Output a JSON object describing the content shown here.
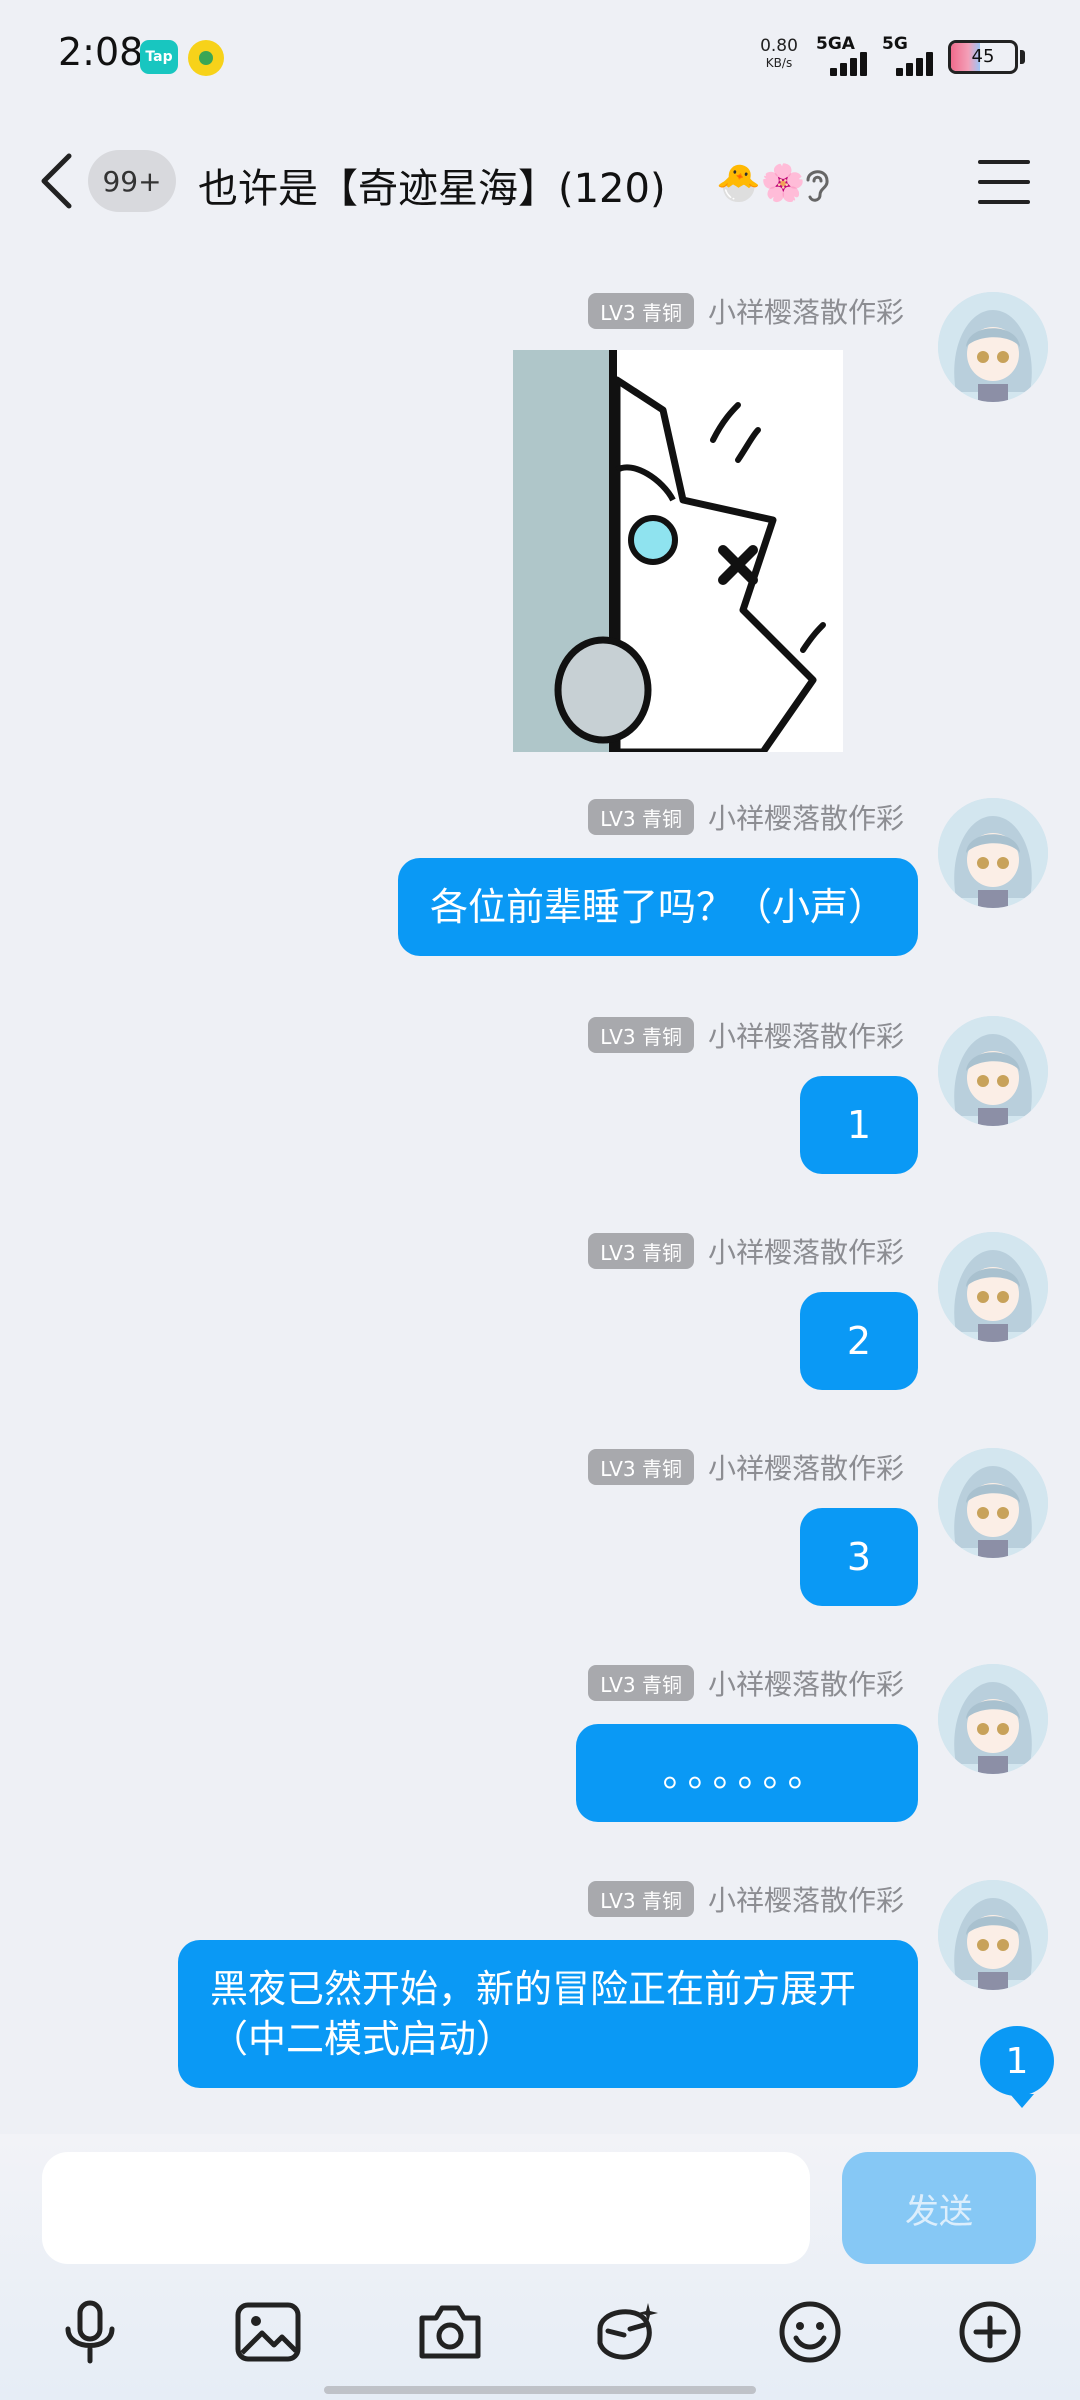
{
  "status_bar": {
    "time": "2:08",
    "tap_app_label": "Tap",
    "speed_value": "0.80",
    "speed_unit": "KB/s",
    "net1": "5GA",
    "net2": "5G",
    "battery": "45",
    "battery_level": 0.45
  },
  "header": {
    "back_icon": "chevron-left-icon",
    "unread_badge": "99+",
    "title": "也许是【奇迹星海】(120)",
    "title_emoji": "🐣🌸",
    "menu_icon": "hamburger-icon"
  },
  "sender": {
    "level": "LV3 青铜",
    "name": "小祥樱落散作彩"
  },
  "messages": [
    {
      "type": "sticker"
    },
    {
      "type": "text",
      "text": "各位前辈睡了吗？（小声）"
    },
    {
      "type": "text",
      "text": "1"
    },
    {
      "type": "text",
      "text": "2"
    },
    {
      "type": "text",
      "text": "3"
    },
    {
      "type": "text",
      "text": "。。。。。。"
    },
    {
      "type": "text",
      "text": "黑夜已然开始，新的冒险正在前方展开（中二模式启动）"
    }
  ],
  "new_message_badge": "1",
  "input": {
    "placeholder": "",
    "send_label": "发送"
  },
  "toolbar": [
    "microphone-icon",
    "image-icon",
    "camera-icon",
    "red-packet-icon",
    "emoji-icon",
    "plus-icon"
  ],
  "colors": {
    "bubble": "#0a99f5",
    "background": "#eef0f5",
    "send_disabled": "#86c8f5"
  }
}
